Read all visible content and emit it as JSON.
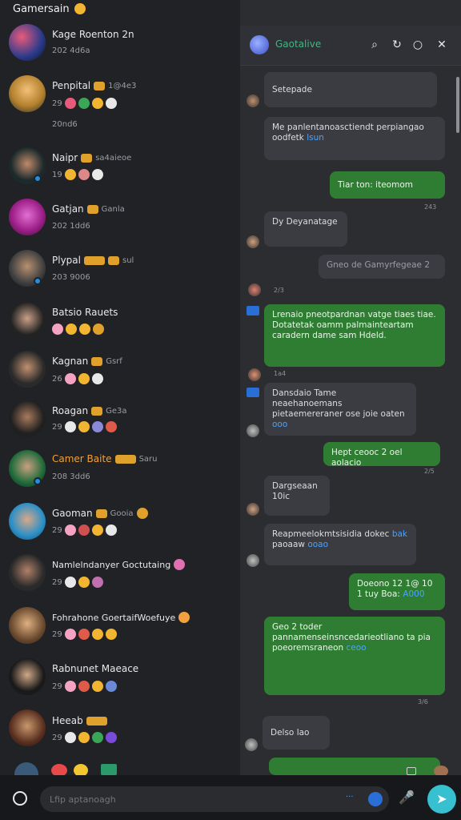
{
  "app": {
    "title": "Gamersain"
  },
  "chats": [
    {
      "name": "Kage Roenton 2n",
      "time": "",
      "sub": "202 4d6a",
      "tag": false,
      "orange": false
    },
    {
      "name": "Penpital",
      "time": "1@4e3",
      "sub": "29",
      "tag": true,
      "orange": false
    },
    {
      "name": "Naipr",
      "time": "sa4aieoe",
      "sub": "19",
      "tag": true,
      "orange": false
    },
    {
      "name": "Gatjan",
      "time": "Ganla",
      "sub": "202 1dd6",
      "tag": true,
      "orange": false
    },
    {
      "name": "Plypal",
      "time": "sul",
      "sub": "203 9006",
      "tag": true,
      "orange": false
    },
    {
      "name": "Batsio Rauets",
      "time": "",
      "sub": "",
      "tag": false,
      "orange": false
    },
    {
      "name": "Kagnan",
      "time": "Gsrf",
      "sub": "26",
      "tag": true,
      "orange": false
    },
    {
      "name": "Roagan",
      "time": "Ge3a",
      "sub": "29",
      "tag": true,
      "orange": false
    },
    {
      "name": "Camer Baite",
      "time": "Saru",
      "sub": "208 3dd6",
      "tag": true,
      "orange": true
    },
    {
      "name": "Gaoman",
      "time": "Gooia",
      "sub": "29",
      "tag": true,
      "orange": false
    },
    {
      "name": "Namlelndanyer Goctutaing",
      "time": "",
      "sub": "29",
      "tag": false,
      "orange": false
    },
    {
      "name": "Fohrahone GoertaifWoefuye",
      "time": "",
      "sub": "29",
      "tag": false,
      "orange": false
    },
    {
      "name": "Rabnunet Maeace",
      "time": "",
      "sub": "29",
      "tag": false,
      "orange": false
    },
    {
      "name": "Heeab",
      "time": "",
      "sub": "29",
      "tag": true,
      "orange": false
    }
  ],
  "chat_date": "20nd6",
  "conversation": {
    "group_name": "Gaotalive",
    "messages": [
      {
        "dir": "in",
        "text": "Setepade"
      },
      {
        "dir": "in",
        "text": "Me panlentanoasctiendt perpiangao oodfetk",
        "link": "lsun"
      },
      {
        "dir": "out",
        "text": "Tiar ton: iteomom"
      },
      {
        "dir": "in",
        "text": "Dy Deyanatage"
      },
      {
        "dir": "in",
        "text": "Gneo de Gamyrfegeae 2"
      },
      {
        "dir": "out",
        "text": "Lrenaio pneotpardnan vatge tiaes tiae. Dotatetak oamm palmainteartam caradern dame sam Hdeld."
      },
      {
        "dir": "in",
        "text": "Dansdaio Tame neaehanoemans pietaemereraner ose joie oaten",
        "link": "ooo"
      },
      {
        "dir": "out",
        "text": "Hept ceooc 2 oel aolacio"
      },
      {
        "dir": "in",
        "text": "Dargseaan 10ic"
      },
      {
        "dir": "in",
        "text": "Reapmeelokmtsisidia dokec",
        "link": "bak",
        "text2": "paoaaw",
        "link2": "ooao"
      },
      {
        "dir": "out",
        "text": "Doeono 12 1@ 10 1 tuy Boa:",
        "link": "A000"
      },
      {
        "dir": "out",
        "text": "Geo 2 toder pannamenseinsncedarieotliano ta pia poeoremsraneon",
        "link": "ceoo"
      },
      {
        "dir": "in",
        "text": "Delso lao"
      }
    ],
    "stamps": [
      "243",
      "2/3",
      "1a4",
      "2/5",
      "3/6"
    ]
  },
  "composer": {
    "placeholder": "Lfip aptanoagh"
  },
  "colors": {
    "accent": "#37c0d0",
    "outgoing": "#2f7d32",
    "incoming": "#3a3c41",
    "link": "#4aa3ff",
    "tag": "#e0a02c"
  }
}
